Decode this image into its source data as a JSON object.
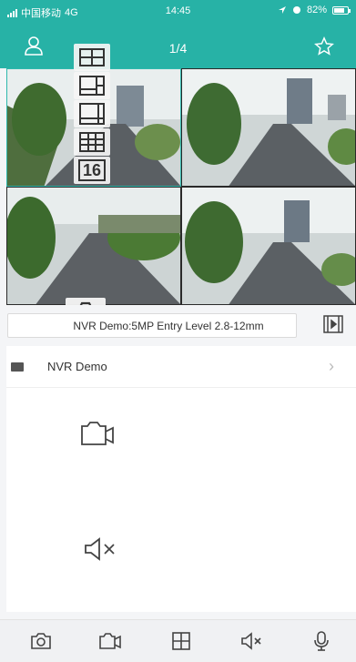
{
  "status_bar": {
    "carrier": "中国移动",
    "network": "4G",
    "time": "14:45",
    "battery_percent": "82%",
    "battery_level": 0.82
  },
  "header": {
    "page_indicator": "1/4"
  },
  "split_menu": {
    "options": [
      {
        "icon": "split-2-icon"
      },
      {
        "icon": "split-4-icon"
      },
      {
        "icon": "split-6-icon"
      },
      {
        "icon": "split-9-icon"
      },
      {
        "label": "16"
      }
    ]
  },
  "channel": {
    "name": "NVR Demo:5MP Entry Level 2.8-12mm"
  },
  "device_list": {
    "items": [
      {
        "name": "NVR Demo"
      }
    ]
  },
  "toolbar": {
    "buttons": [
      {
        "icon": "snapshot-icon"
      },
      {
        "icon": "record-icon"
      },
      {
        "icon": "split-screen-icon"
      },
      {
        "icon": "mute-icon"
      },
      {
        "icon": "microphone-icon"
      }
    ]
  },
  "colors": {
    "accent": "#27b2a6",
    "background": "#f4f5f7"
  }
}
